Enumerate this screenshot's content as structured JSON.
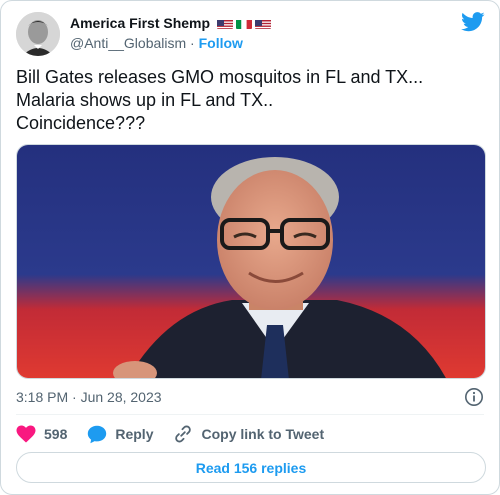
{
  "user": {
    "display_name": "America First Shemp",
    "handle": "@Anti__Globalism",
    "separator": " · ",
    "follow_label": "Follow",
    "flags": [
      "us-flag",
      "italy-flag",
      "us-flag"
    ]
  },
  "tweet": {
    "text": "Bill Gates releases GMO mosquitos in FL and TX...\nMalaria shows up in FL and TX..\nCoincidence???",
    "timestamp": "3:18 PM · Jun 28, 2023"
  },
  "actions": {
    "like_count": "598",
    "reply_label": "Reply",
    "copy_link_label": "Copy link to Tweet"
  },
  "footer": {
    "read_replies_label": "Read 156 replies"
  },
  "colors": {
    "accent": "#1d9bf0",
    "like": "#f91880",
    "muted": "#536471",
    "text": "#0f1419",
    "media_bg_top": "#1f2f7a",
    "media_bg_bottom": "#d9302f"
  },
  "icons": {
    "brand": "twitter-bird-icon",
    "info": "info-icon",
    "like": "heart-icon",
    "reply": "speech-bubble-icon",
    "copy": "link-icon"
  }
}
